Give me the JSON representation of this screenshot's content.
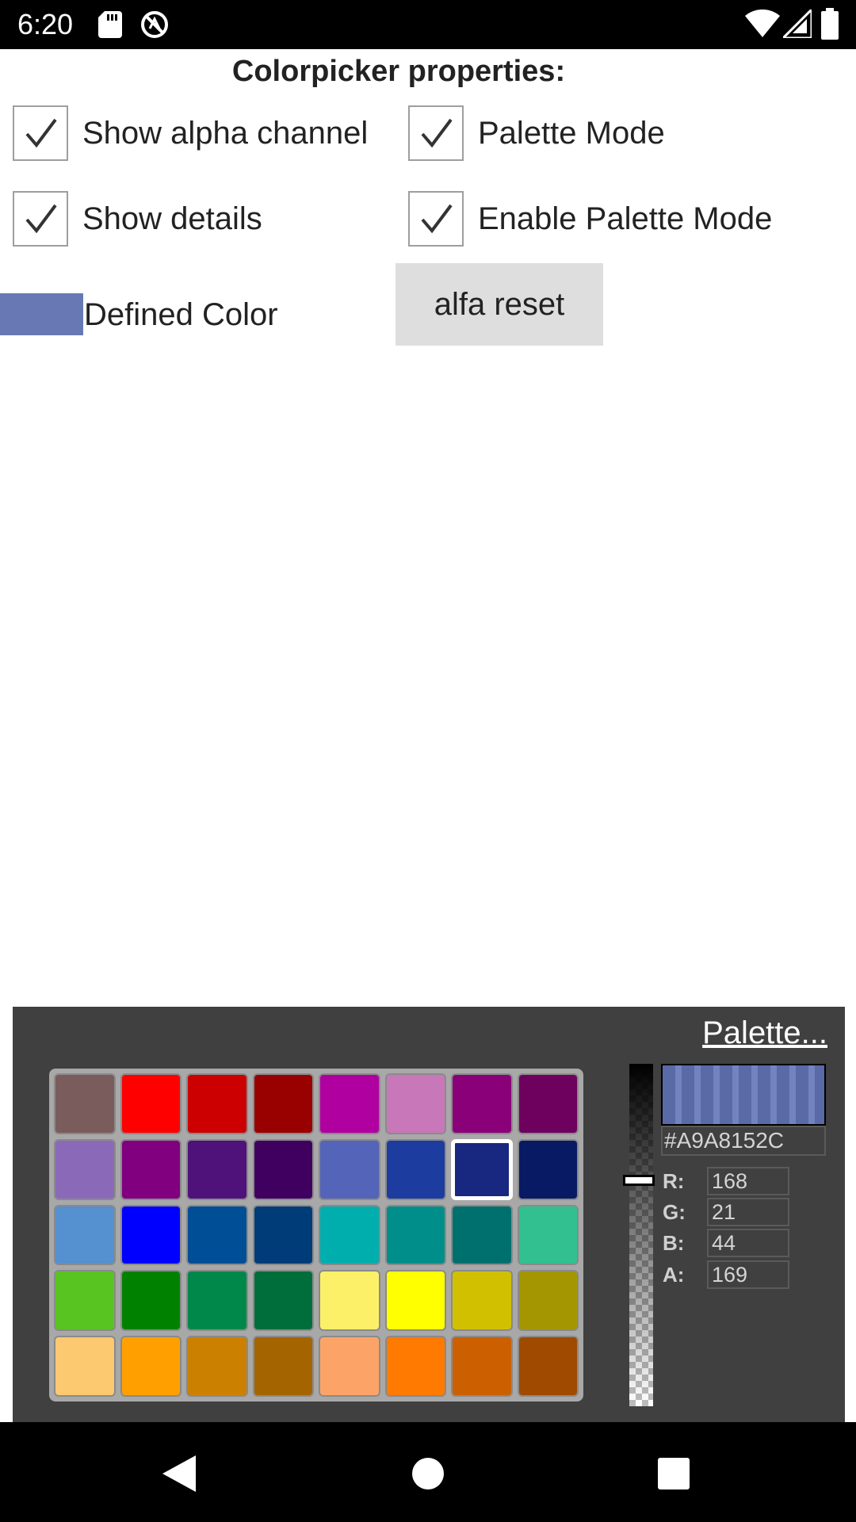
{
  "status_bar": {
    "time": "6:20"
  },
  "header": {
    "title": "Colorpicker properties:"
  },
  "options": {
    "show_alpha": {
      "label": "Show alpha channel",
      "checked": true
    },
    "palette_mode": {
      "label": "Palette Mode",
      "checked": true
    },
    "show_details": {
      "label": "Show details",
      "checked": true
    },
    "enable_palette_mode": {
      "label": "Enable Palette Mode",
      "checked": true
    }
  },
  "defined_color": {
    "label": "Defined Color",
    "color": "#6878B4"
  },
  "alfa_reset": {
    "label": "alfa reset"
  },
  "picker": {
    "palette_link": "Palette...",
    "hex": "#A9A8152C",
    "channels": [
      {
        "label": "R:",
        "value": "168"
      },
      {
        "label": "G:",
        "value": "21"
      },
      {
        "label": "B:",
        "value": "44"
      },
      {
        "label": "A:",
        "value": "169"
      }
    ],
    "alpha_level": 0.66,
    "selected_index": 14,
    "palette": [
      "#7A5C5C",
      "#FF0000",
      "#CC0000",
      "#990000",
      "#B000A0",
      "#C878B8",
      "#8A0078",
      "#6E005E",
      "#8A6AB8",
      "#800080",
      "#4E127A",
      "#3F0060",
      "#5464B8",
      "#1C3CA0",
      "#182880",
      "#081A64",
      "#5590D0",
      "#0000FF",
      "#004E96",
      "#003C78",
      "#00AEAE",
      "#008E8A",
      "#00706E",
      "#32C090",
      "#58C422",
      "#008200",
      "#00884A",
      "#006E3A",
      "#FCF068",
      "#FFFF00",
      "#D0C000",
      "#A49600",
      "#FCC870",
      "#FFA000",
      "#CC8000",
      "#A46400",
      "#FCA468",
      "#FF7A00",
      "#CC6000",
      "#A04A00"
    ]
  }
}
